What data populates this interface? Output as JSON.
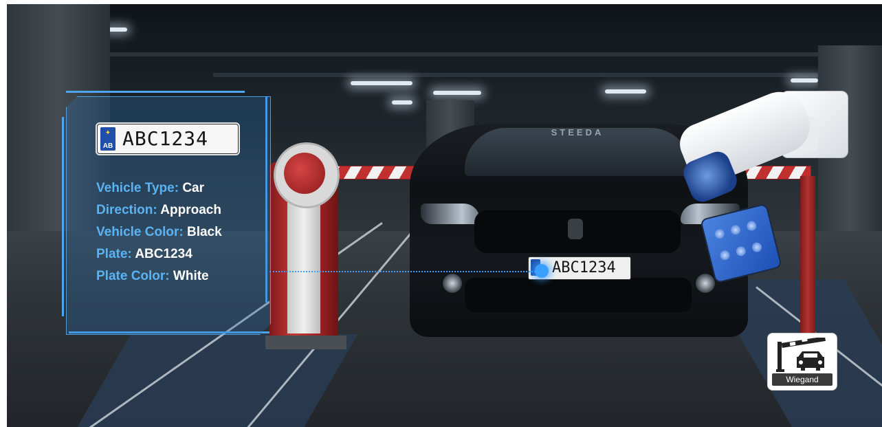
{
  "plate_card": {
    "country_code": "AB",
    "plate_number": "ABC1234"
  },
  "vehicle_info": [
    {
      "label": "Vehicle Type:",
      "value": "Car"
    },
    {
      "label": "Direction:",
      "value": "Approach"
    },
    {
      "label": "Vehicle Color:",
      "value": "Black"
    },
    {
      "label": "Plate:",
      "value": "ABC1234"
    },
    {
      "label": "Plate Color:",
      "value": "White"
    }
  ],
  "car": {
    "brand_text": "STEEDA",
    "plate_number": "ABC1234"
  },
  "wiegand_badge": {
    "label": "Wiegand",
    "icon": "barrier-car-icon"
  },
  "colors": {
    "accent_blue": "#5ab3f2",
    "barrier_red": "#c22f2f",
    "scan_line": "#39a0ff"
  }
}
